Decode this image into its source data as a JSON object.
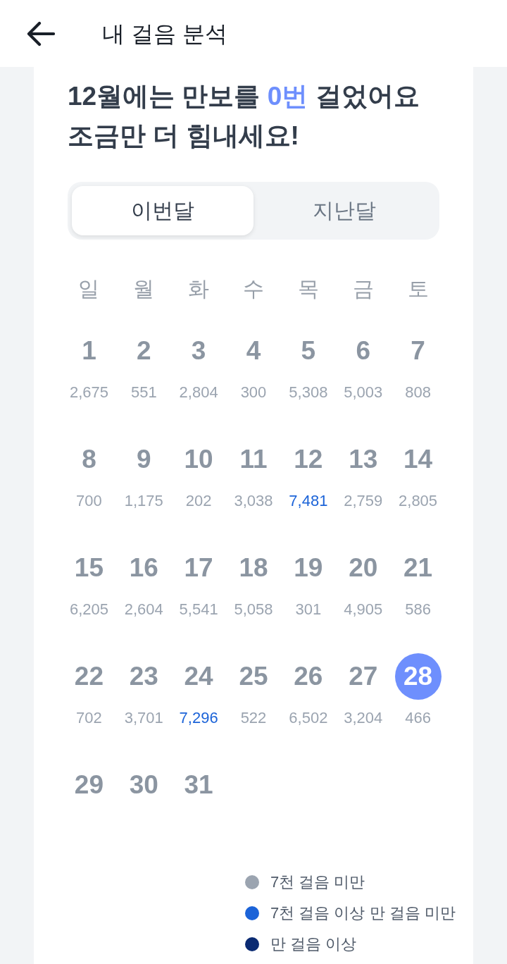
{
  "header": {
    "title": "내 걸음 분석"
  },
  "headline": {
    "lead": "12월에는 만보를",
    "highlight": "0번",
    "trail": "걸었어요"
  },
  "subline": "조금만 더 힘내세요!",
  "tabs": [
    {
      "label": "이번달",
      "selected": true
    },
    {
      "label": "지난달",
      "selected": false
    }
  ],
  "weekdays": [
    "일",
    "월",
    "화",
    "수",
    "목",
    "금",
    "토"
  ],
  "days": [
    {
      "day": "1",
      "steps": "2,675",
      "color": "#9ba4b0",
      "selected": false
    },
    {
      "day": "2",
      "steps": "551",
      "color": "#9ba4b0",
      "selected": false
    },
    {
      "day": "3",
      "steps": "2,804",
      "color": "#9ba4b0",
      "selected": false
    },
    {
      "day": "4",
      "steps": "300",
      "color": "#9ba4b0",
      "selected": false
    },
    {
      "day": "5",
      "steps": "5,308",
      "color": "#9ba4b0",
      "selected": false
    },
    {
      "day": "6",
      "steps": "5,003",
      "color": "#9ba4b0",
      "selected": false
    },
    {
      "day": "7",
      "steps": "808",
      "color": "#9ba4b0",
      "selected": false
    },
    {
      "day": "8",
      "steps": "700",
      "color": "#9ba4b0",
      "selected": false
    },
    {
      "day": "9",
      "steps": "1,175",
      "color": "#9ba4b0",
      "selected": false
    },
    {
      "day": "10",
      "steps": "202",
      "color": "#9ba4b0",
      "selected": false
    },
    {
      "day": "11",
      "steps": "3,038",
      "color": "#9ba4b0",
      "selected": false
    },
    {
      "day": "12",
      "steps": "7,481",
      "color": "#1b63d8",
      "selected": false
    },
    {
      "day": "13",
      "steps": "2,759",
      "color": "#9ba4b0",
      "selected": false
    },
    {
      "day": "14",
      "steps": "2,805",
      "color": "#9ba4b0",
      "selected": false
    },
    {
      "day": "15",
      "steps": "6,205",
      "color": "#9ba4b0",
      "selected": false
    },
    {
      "day": "16",
      "steps": "2,604",
      "color": "#9ba4b0",
      "selected": false
    },
    {
      "day": "17",
      "steps": "5,541",
      "color": "#9ba4b0",
      "selected": false
    },
    {
      "day": "18",
      "steps": "5,058",
      "color": "#9ba4b0",
      "selected": false
    },
    {
      "day": "19",
      "steps": "301",
      "color": "#9ba4b0",
      "selected": false
    },
    {
      "day": "20",
      "steps": "4,905",
      "color": "#9ba4b0",
      "selected": false
    },
    {
      "day": "21",
      "steps": "586",
      "color": "#9ba4b0",
      "selected": false
    },
    {
      "day": "22",
      "steps": "702",
      "color": "#9ba4b0",
      "selected": false
    },
    {
      "day": "23",
      "steps": "3,701",
      "color": "#9ba4b0",
      "selected": false
    },
    {
      "day": "24",
      "steps": "7,296",
      "color": "#1b63d8",
      "selected": false
    },
    {
      "day": "25",
      "steps": "522",
      "color": "#9ba4b0",
      "selected": false
    },
    {
      "day": "26",
      "steps": "6,502",
      "color": "#9ba4b0",
      "selected": false
    },
    {
      "day": "27",
      "steps": "3,204",
      "color": "#9ba4b0",
      "selected": false
    },
    {
      "day": "28",
      "steps": "466",
      "color": "#9ba4b0",
      "selected": true
    },
    {
      "day": "29",
      "selected": false
    },
    {
      "day": "30",
      "selected": false
    },
    {
      "day": "31",
      "selected": false
    }
  ],
  "legend": [
    {
      "label": "7천 걸음 미만",
      "color": "#9ba4b0"
    },
    {
      "label": "7천 걸음 이상 만 걸음 미만",
      "color": "#1b63d8"
    },
    {
      "label": "만 걸음 이상",
      "color": "#0a2a72"
    }
  ]
}
